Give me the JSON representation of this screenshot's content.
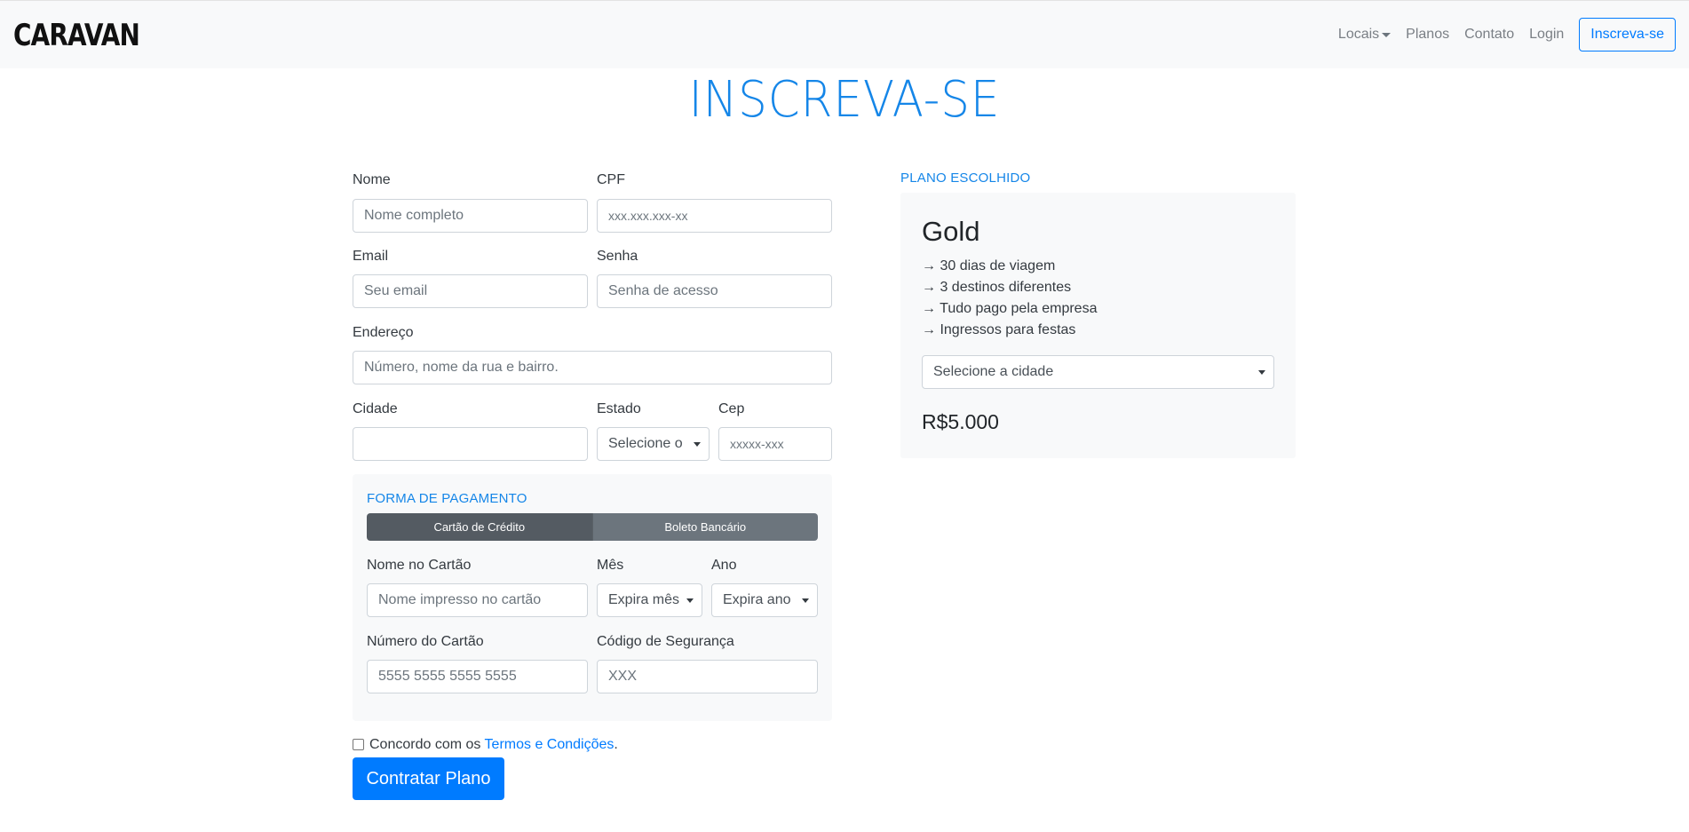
{
  "nav": {
    "brand": "CARAVAN",
    "locais": "Locais",
    "planos": "Planos",
    "contato": "Contato",
    "login": "Login",
    "signup": "Inscreva-se"
  },
  "page_title": "INSCREVA-SE",
  "form": {
    "nome_label": "Nome",
    "nome_placeholder": "Nome completo",
    "cpf_label": "CPF",
    "cpf_placeholder": "xxx.xxx.xxx-xx",
    "email_label": "Email",
    "email_placeholder": "Seu email",
    "senha_label": "Senha",
    "senha_placeholder": "Senha de acesso",
    "endereco_label": "Endereço",
    "endereco_placeholder": "Número, nome da rua e bairro.",
    "cidade_label": "Cidade",
    "cidade_value": "",
    "estado_label": "Estado",
    "estado_selected": "Selecione o",
    "cep_label": "Cep",
    "cep_placeholder": "xxxxx-xxx"
  },
  "payment": {
    "title": "FORMA DE PAGAMENTO",
    "tabs": [
      "Cartão de Crédito",
      "Boleto Bancário"
    ],
    "nome_cartao_label": "Nome no Cartão",
    "nome_cartao_placeholder": "Nome impresso no cartão",
    "mes_label": "Mês",
    "mes_selected": "Expira mês",
    "ano_label": "Ano",
    "ano_selected": "Expira ano",
    "numero_label": "Número do Cartão",
    "numero_placeholder": "5555 5555 5555 5555",
    "codigo_label": "Código de Segurança",
    "codigo_placeholder": "XXX"
  },
  "terms": {
    "prefix": "Concordo com os ",
    "link": "Termos e Condições",
    "suffix": ".",
    "checked": false
  },
  "submit_label": "Contratar Plano",
  "plan": {
    "section_title": "PLANO ESCOLHIDO",
    "name": "Gold",
    "features": [
      "→ 30 dias de viagem",
      "→ 3 destinos diferentes",
      "→ Tudo pago pela empresa",
      "→ Ingressos para festas"
    ],
    "city_select": "Selecione a cidade",
    "price": "R$5.000"
  },
  "colors": {
    "accent": "#007bff",
    "title": "#1586e8",
    "panel": "#f8f9fa"
  }
}
